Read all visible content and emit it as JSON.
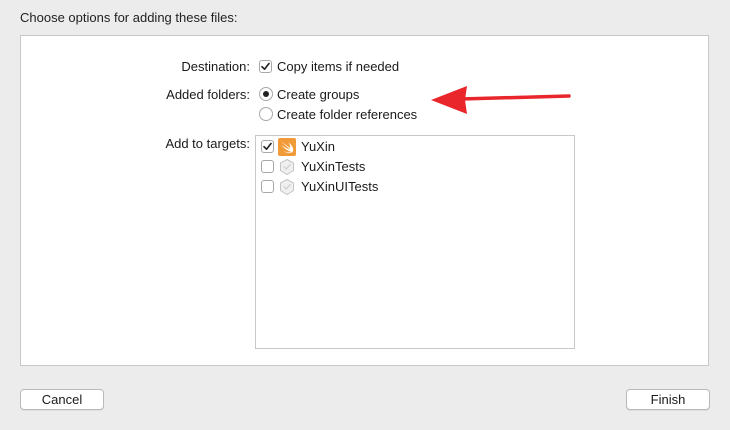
{
  "header": {
    "title": "Choose options for adding these files:"
  },
  "destination": {
    "label": "Destination:",
    "option_label": "Copy items if needed",
    "checked": true
  },
  "added_folders": {
    "label": "Added folders:",
    "options": [
      {
        "label": "Create groups",
        "selected": true
      },
      {
        "label": "Create folder references",
        "selected": false
      }
    ]
  },
  "targets": {
    "label": "Add to targets:",
    "items": [
      {
        "name": "YuXin",
        "checked": true,
        "icon": "swift-app-icon"
      },
      {
        "name": "YuXinTests",
        "checked": false,
        "icon": "test-target-icon"
      },
      {
        "name": "YuXinUITests",
        "checked": false,
        "icon": "test-target-icon"
      }
    ]
  },
  "buttons": {
    "cancel": "Cancel",
    "finish": "Finish"
  },
  "colors": {
    "annotation_arrow": "#e8262b",
    "app_icon": "#f19a38"
  }
}
